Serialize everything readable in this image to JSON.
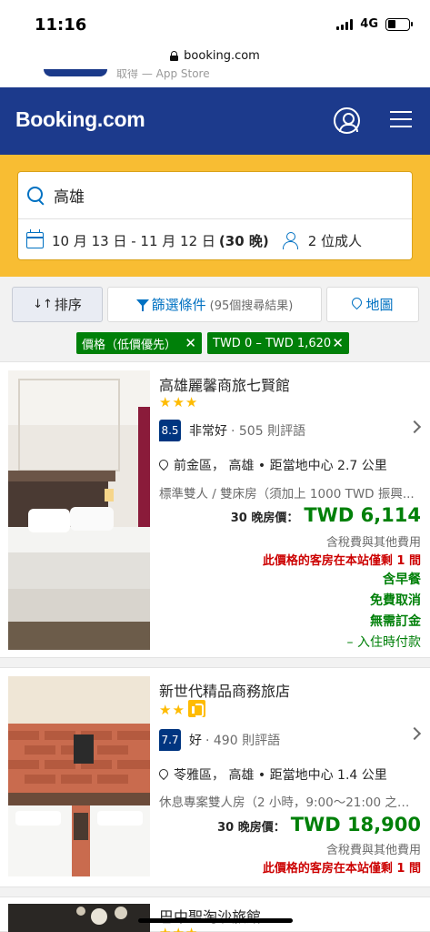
{
  "status_bar": {
    "time": "11:16",
    "network": "4G"
  },
  "browser": {
    "url": "booking.com"
  },
  "banner": {
    "text": "取得 — App Store"
  },
  "header": {
    "logo": "Booking.com"
  },
  "search": {
    "destination": "高雄",
    "dates": "10 月 13 日 - 11 月 12 日",
    "nights": "(30 晚)",
    "guests": "2 位成人"
  },
  "toolbar": {
    "sort_icon": "↓↑",
    "sort_label": "排序",
    "filter_label": "篩選條件",
    "filter_count": "(95個搜尋結果)",
    "map_label": "地圖"
  },
  "chips": [
    {
      "label": "價格（低價優先）",
      "close": "✕"
    },
    {
      "label": "TWD 0 – TWD 1,620",
      "close": "✕"
    }
  ],
  "properties": [
    {
      "name": "高雄麗馨商旅七賢館",
      "stars": "★★★",
      "score": "8.5",
      "score_word": "非常好",
      "reviews": "· 505 則評語",
      "location": "前金區， 高雄 • 距當地中心 2.7 公里",
      "room": "標準雙人 / 雙床房（須加上 1000 TWD 振興...",
      "nights_label": "30 晚房價：",
      "price": "TWD 6,114",
      "taxes": "含稅費與其他費用",
      "scarcity": "此價格的客房在本站僅剩 1 間",
      "perks": [
        "含早餐",
        "免費取消",
        "無需訂金"
      ],
      "pay_note": "– 入住時付款"
    },
    {
      "name": "新世代精品商務旅店",
      "stars": "★★",
      "score": "7.7",
      "score_word": "好",
      "reviews": "· 490 則評語",
      "location": "苓雅區， 高雄 • 距當地中心 1.4 公里",
      "room": "休息專案雙人房（2 小時，9:00～21:00 之間...",
      "nights_label": "30 晚房價：",
      "price": "TWD 18,900",
      "taxes": "含稅費與其他費用",
      "scarcity": "此價格的客房在本站僅剩 1 間"
    },
    {
      "name": "巴中聖淘沙旅館",
      "stars": "★★★"
    }
  ],
  "colors": {
    "brand_blue": "#1c3a8c",
    "search_yellow": "#f8bd33",
    "price_green": "#008009",
    "scarcity_red": "#cc0000",
    "star_yellow": "#febb02",
    "link_blue": "#0071c2"
  }
}
